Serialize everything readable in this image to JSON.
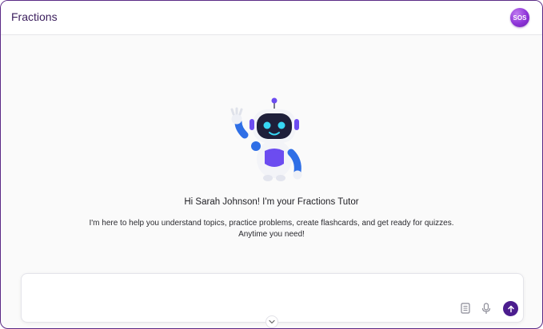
{
  "header": {
    "title": "Fractions",
    "sos_label": "SOS"
  },
  "welcome": {
    "greeting": "Hi Sarah Johnson! I'm your Fractions Tutor",
    "description": "I'm here to help you understand topics, practice problems, create flashcards, and get ready for quizzes. Anytime you need!"
  },
  "composer": {
    "placeholder": "",
    "value": ""
  },
  "icons": {
    "notes": "notes-icon",
    "microphone": "microphone-icon",
    "send": "arrow-up-icon",
    "collapse": "chevron-down-icon",
    "mascot": "robot-mascot"
  },
  "colors": {
    "brand": "#4b1d8e",
    "sos_badge": "#8e34d8",
    "robot_accent": "#6c4cf0",
    "robot_eyes": "#37d7f5"
  }
}
